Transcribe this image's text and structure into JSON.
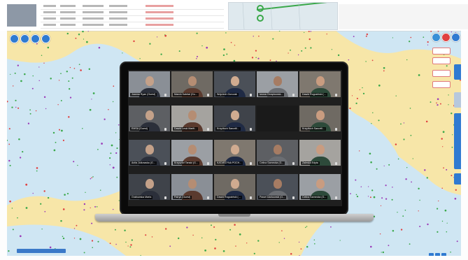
{
  "app": {
    "name": "Maritime traffic map with video conference overlay"
  },
  "colors": {
    "map_land": "#f7e6a8",
    "map_sea": "#cfe6f3",
    "accent": "#2f7ad1",
    "vessel_green": "#3aa84a",
    "vessel_red": "#e04040",
    "vessel_purple": "#9b3bb8"
  },
  "map_controls": {
    "left": [
      "zoom-in-icon",
      "zoom-out-icon",
      "layers-icon",
      "settings-icon"
    ],
    "right": [
      "search-icon",
      "pin-icon",
      "menu-icon"
    ]
  },
  "side_tabs": [
    {
      "label": ""
    },
    {
      "label": ""
    },
    {
      "label": ""
    },
    {
      "label": ""
    }
  ],
  "conference": {
    "participants": [
      {
        "name": "Joanna Ryan (Guest)"
      },
      {
        "name": "Marcin Kaletal (Gu..."
      },
      {
        "name": "Wojciech Gorczak"
      },
      {
        "name": "Iwona Chrapkowsk..."
      },
      {
        "name": "Dawid Rogoziński (..."
      },
      {
        "name": "EMSA (Guest)"
      },
      {
        "name": "Dawid Leski Mariti..."
      },
      {
        "name": "Krzyżtoch Sancrtli..."
      },
      {
        "name": ""
      },
      {
        "name": "Krzyżtoch Sancrtli..."
      },
      {
        "name": "Anita Julkowska (G..."
      },
      {
        "name": "Krzysztof Tanski (G..."
      },
      {
        "name": "KATARZYNA POCH..."
      },
      {
        "name": "Celina Sarnecka (G..."
      },
      {
        "name": "Zaleska Edyta"
      },
      {
        "name": "Grabowska Marta"
      },
      {
        "name": "Patryk (Guest)"
      },
      {
        "name": "Dawid Rogoziński (..."
      },
      {
        "name": "Paweł Dankowski (G..."
      },
      {
        "name": "Celina Sarnecka (G..."
      }
    ]
  }
}
